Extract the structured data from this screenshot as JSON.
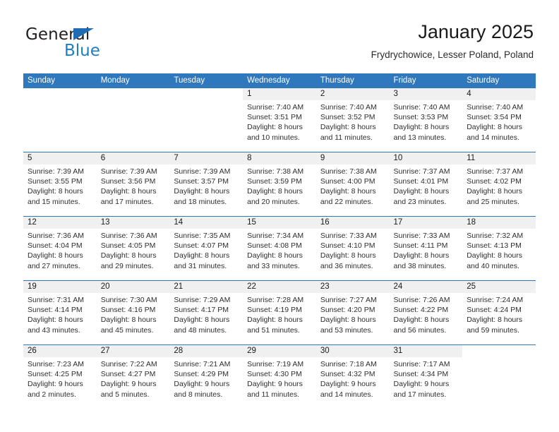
{
  "brand": {
    "name_top": "General",
    "name_bottom": "Blue",
    "accent_color": "#1d7fc3",
    "triangle_color": "#1f6cb4"
  },
  "header": {
    "title": "January 2025",
    "subtitle": "Frydrychowice, Lesser Poland, Poland"
  },
  "theme": {
    "header_row_bg": "#2f78bd",
    "header_row_text": "#ffffff",
    "daynum_band_bg": "#f0f0f0",
    "row_divider": "#2f78bd"
  },
  "weekday_headers": [
    "Sunday",
    "Monday",
    "Tuesday",
    "Wednesday",
    "Thursday",
    "Friday",
    "Saturday"
  ],
  "weeks": [
    [
      {
        "day": "",
        "blank": true,
        "lines": []
      },
      {
        "day": "",
        "blank": true,
        "lines": []
      },
      {
        "day": "",
        "blank": true,
        "lines": []
      },
      {
        "day": "1",
        "lines": [
          "Sunrise: 7:40 AM",
          "Sunset: 3:51 PM",
          "Daylight: 8 hours",
          "and 10 minutes."
        ]
      },
      {
        "day": "2",
        "lines": [
          "Sunrise: 7:40 AM",
          "Sunset: 3:52 PM",
          "Daylight: 8 hours",
          "and 11 minutes."
        ]
      },
      {
        "day": "3",
        "lines": [
          "Sunrise: 7:40 AM",
          "Sunset: 3:53 PM",
          "Daylight: 8 hours",
          "and 13 minutes."
        ]
      },
      {
        "day": "4",
        "lines": [
          "Sunrise: 7:40 AM",
          "Sunset: 3:54 PM",
          "Daylight: 8 hours",
          "and 14 minutes."
        ]
      }
    ],
    [
      {
        "day": "5",
        "lines": [
          "Sunrise: 7:39 AM",
          "Sunset: 3:55 PM",
          "Daylight: 8 hours",
          "and 15 minutes."
        ]
      },
      {
        "day": "6",
        "lines": [
          "Sunrise: 7:39 AM",
          "Sunset: 3:56 PM",
          "Daylight: 8 hours",
          "and 17 minutes."
        ]
      },
      {
        "day": "7",
        "lines": [
          "Sunrise: 7:39 AM",
          "Sunset: 3:57 PM",
          "Daylight: 8 hours",
          "and 18 minutes."
        ]
      },
      {
        "day": "8",
        "lines": [
          "Sunrise: 7:38 AM",
          "Sunset: 3:59 PM",
          "Daylight: 8 hours",
          "and 20 minutes."
        ]
      },
      {
        "day": "9",
        "lines": [
          "Sunrise: 7:38 AM",
          "Sunset: 4:00 PM",
          "Daylight: 8 hours",
          "and 22 minutes."
        ]
      },
      {
        "day": "10",
        "lines": [
          "Sunrise: 7:37 AM",
          "Sunset: 4:01 PM",
          "Daylight: 8 hours",
          "and 23 minutes."
        ]
      },
      {
        "day": "11",
        "lines": [
          "Sunrise: 7:37 AM",
          "Sunset: 4:02 PM",
          "Daylight: 8 hours",
          "and 25 minutes."
        ]
      }
    ],
    [
      {
        "day": "12",
        "lines": [
          "Sunrise: 7:36 AM",
          "Sunset: 4:04 PM",
          "Daylight: 8 hours",
          "and 27 minutes."
        ]
      },
      {
        "day": "13",
        "lines": [
          "Sunrise: 7:36 AM",
          "Sunset: 4:05 PM",
          "Daylight: 8 hours",
          "and 29 minutes."
        ]
      },
      {
        "day": "14",
        "lines": [
          "Sunrise: 7:35 AM",
          "Sunset: 4:07 PM",
          "Daylight: 8 hours",
          "and 31 minutes."
        ]
      },
      {
        "day": "15",
        "lines": [
          "Sunrise: 7:34 AM",
          "Sunset: 4:08 PM",
          "Daylight: 8 hours",
          "and 33 minutes."
        ]
      },
      {
        "day": "16",
        "lines": [
          "Sunrise: 7:33 AM",
          "Sunset: 4:10 PM",
          "Daylight: 8 hours",
          "and 36 minutes."
        ]
      },
      {
        "day": "17",
        "lines": [
          "Sunrise: 7:33 AM",
          "Sunset: 4:11 PM",
          "Daylight: 8 hours",
          "and 38 minutes."
        ]
      },
      {
        "day": "18",
        "lines": [
          "Sunrise: 7:32 AM",
          "Sunset: 4:13 PM",
          "Daylight: 8 hours",
          "and 40 minutes."
        ]
      }
    ],
    [
      {
        "day": "19",
        "lines": [
          "Sunrise: 7:31 AM",
          "Sunset: 4:14 PM",
          "Daylight: 8 hours",
          "and 43 minutes."
        ]
      },
      {
        "day": "20",
        "lines": [
          "Sunrise: 7:30 AM",
          "Sunset: 4:16 PM",
          "Daylight: 8 hours",
          "and 45 minutes."
        ]
      },
      {
        "day": "21",
        "lines": [
          "Sunrise: 7:29 AM",
          "Sunset: 4:17 PM",
          "Daylight: 8 hours",
          "and 48 minutes."
        ]
      },
      {
        "day": "22",
        "lines": [
          "Sunrise: 7:28 AM",
          "Sunset: 4:19 PM",
          "Daylight: 8 hours",
          "and 51 minutes."
        ]
      },
      {
        "day": "23",
        "lines": [
          "Sunrise: 7:27 AM",
          "Sunset: 4:20 PM",
          "Daylight: 8 hours",
          "and 53 minutes."
        ]
      },
      {
        "day": "24",
        "lines": [
          "Sunrise: 7:26 AM",
          "Sunset: 4:22 PM",
          "Daylight: 8 hours",
          "and 56 minutes."
        ]
      },
      {
        "day": "25",
        "lines": [
          "Sunrise: 7:24 AM",
          "Sunset: 4:24 PM",
          "Daylight: 8 hours",
          "and 59 minutes."
        ]
      }
    ],
    [
      {
        "day": "26",
        "lines": [
          "Sunrise: 7:23 AM",
          "Sunset: 4:25 PM",
          "Daylight: 9 hours",
          "and 2 minutes."
        ]
      },
      {
        "day": "27",
        "lines": [
          "Sunrise: 7:22 AM",
          "Sunset: 4:27 PM",
          "Daylight: 9 hours",
          "and 5 minutes."
        ]
      },
      {
        "day": "28",
        "lines": [
          "Sunrise: 7:21 AM",
          "Sunset: 4:29 PM",
          "Daylight: 9 hours",
          "and 8 minutes."
        ]
      },
      {
        "day": "29",
        "lines": [
          "Sunrise: 7:19 AM",
          "Sunset: 4:30 PM",
          "Daylight: 9 hours",
          "and 11 minutes."
        ]
      },
      {
        "day": "30",
        "lines": [
          "Sunrise: 7:18 AM",
          "Sunset: 4:32 PM",
          "Daylight: 9 hours",
          "and 14 minutes."
        ]
      },
      {
        "day": "31",
        "lines": [
          "Sunrise: 7:17 AM",
          "Sunset: 4:34 PM",
          "Daylight: 9 hours",
          "and 17 minutes."
        ]
      },
      {
        "day": "",
        "blank": true,
        "lines": []
      }
    ]
  ]
}
